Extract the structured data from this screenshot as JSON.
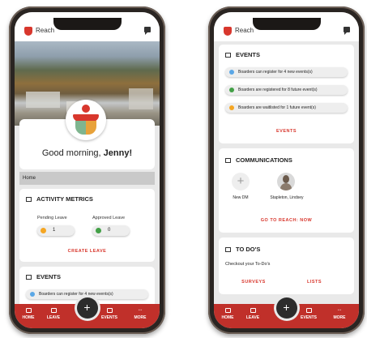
{
  "app": {
    "name": "Reach"
  },
  "left_phone": {
    "greeting_prefix": "Good morning, ",
    "greeting_name": "Jenny!",
    "breadcrumb": "Home",
    "activity_metrics": {
      "title": "ACTIVITY METRICS",
      "pending_label": "Pending Leave",
      "pending_value": "1",
      "approved_label": "Approved Leave",
      "approved_value": "0",
      "create_label": "CREATE LEAVE"
    },
    "events": {
      "title": "EVENTS",
      "partial_item": "Boarders can register for 4 new events(s)"
    }
  },
  "right_phone": {
    "events": {
      "title": "EVENTS",
      "items": [
        {
          "text": "Boarders can register for 4 new events(s)",
          "color": "#5aa7e6"
        },
        {
          "text": "Boarders are registered for 8 future event(s)",
          "color": "#43a047"
        },
        {
          "text": "Boarders are waitlisted for 1 future event(s)",
          "color": "#f5a623"
        }
      ],
      "link": "EVENTS"
    },
    "communications": {
      "title": "COMMUNICATIONS",
      "new_dm": "New DM",
      "contact": "Stapleton, Lindsey",
      "link": "GO TO REACH: NOW"
    },
    "todos": {
      "title": "TO DO'S",
      "subtitle": "Checkout your To-Do's",
      "surveys": "SURVEYS",
      "lists": "LISTS"
    }
  },
  "bottom_nav": {
    "home": "HOME",
    "leave": "LEAVE",
    "events": "EVENTS",
    "more": "MORE",
    "fab": "+"
  },
  "colors": {
    "brand_red": "#d8372d",
    "nav_red": "#c0302a",
    "pending_dot": "#f5a623",
    "approved_dot": "#43a047"
  }
}
